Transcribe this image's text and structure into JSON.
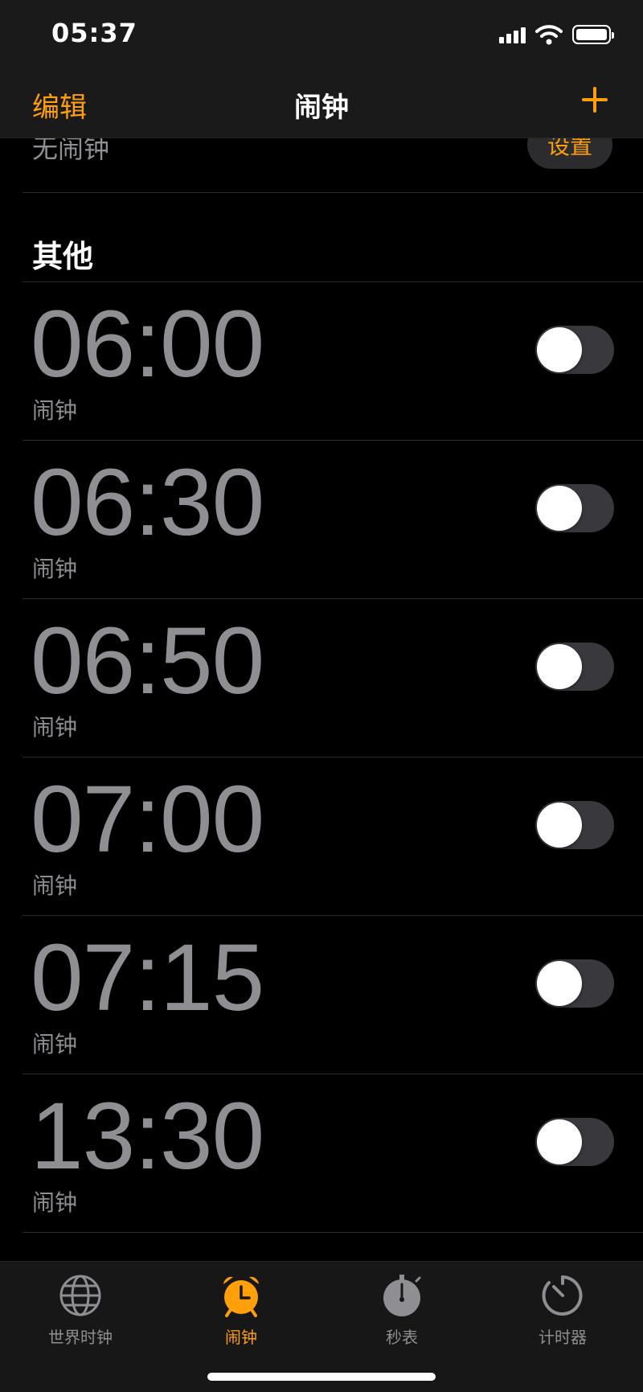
{
  "status_bar": {
    "time": "05:37"
  },
  "nav": {
    "edit_label": "编辑",
    "title": "闹钟"
  },
  "top_section": {
    "no_alarm_text": "无闹钟",
    "setup_label": "设置"
  },
  "other_section": {
    "header": "其他"
  },
  "alarms": [
    {
      "time": "06:00",
      "label": "闹钟",
      "enabled": false
    },
    {
      "time": "06:30",
      "label": "闹钟",
      "enabled": false
    },
    {
      "time": "06:50",
      "label": "闹钟",
      "enabled": false
    },
    {
      "time": "07:00",
      "label": "闹钟",
      "enabled": false
    },
    {
      "time": "07:15",
      "label": "闹钟",
      "enabled": false
    },
    {
      "time": "13:30",
      "label": "闹钟",
      "enabled": false
    }
  ],
  "tabs": [
    {
      "label": "世界时钟",
      "icon": "globe-icon",
      "active": false
    },
    {
      "label": "闹钟",
      "icon": "alarm-clock-icon",
      "active": true
    },
    {
      "label": "秒表",
      "icon": "stopwatch-icon",
      "active": false
    },
    {
      "label": "计时器",
      "icon": "timer-icon",
      "active": false
    }
  ],
  "colors": {
    "accent": "#ff9f0a",
    "secondary_text": "#8e8e93",
    "background": "#000000"
  }
}
